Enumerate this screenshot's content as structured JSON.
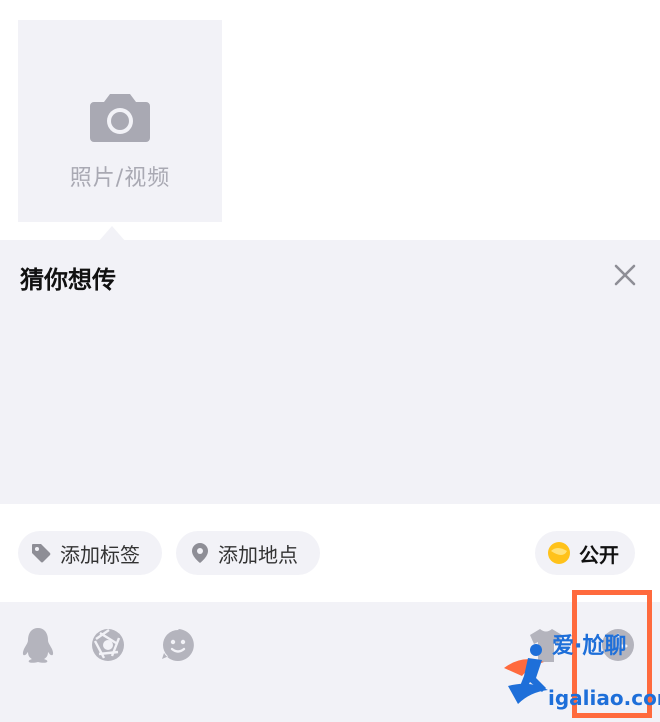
{
  "upload": {
    "label": "照片/视频",
    "icon": "camera-icon"
  },
  "suggestion": {
    "title": "猜你想传",
    "close_icon": "close-icon"
  },
  "pills": {
    "tag_label": "添加标签",
    "location_label": "添加地点",
    "privacy_label": "公开"
  },
  "toolbar": {
    "icons": [
      "qq-penguin-icon",
      "aperture-icon",
      "emoji-icon",
      "shirt-icon",
      "clock-icon"
    ]
  },
  "watermark": {
    "cn": "爱·尬聊",
    "url": "igaliao.com"
  },
  "colors": {
    "panel_bg": "#f2f2f7",
    "icon_gray": "#a9a9b3",
    "highlight": "#ff6a3d",
    "watermark_blue": "#1e6fd9",
    "privacy_yellow": "#ffc21a"
  }
}
